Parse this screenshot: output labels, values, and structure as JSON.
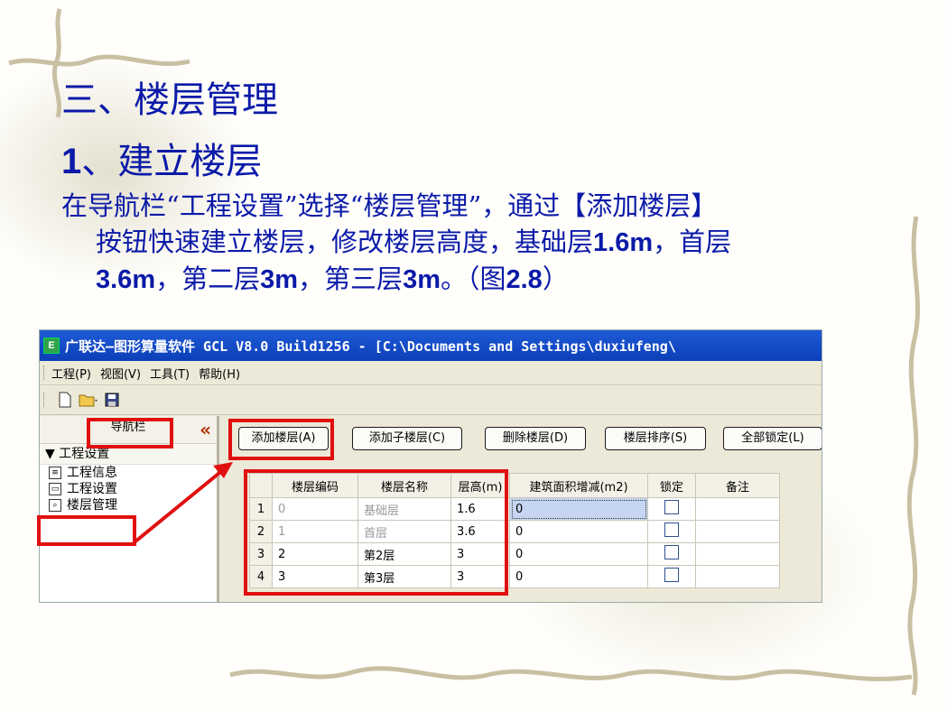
{
  "slide": {
    "title": "三、楼层管理",
    "subtitle_num": "1",
    "subtitle_text": "、建立楼层",
    "body_line1": "在导航栏“工程设置”选择“楼层管理”，通过【添加楼层】",
    "body_line2_a": "按钮快速建立楼层，修改楼层高度，基础层",
    "body_line2_b": "1.6m",
    "body_line2_c": "，首层",
    "body_line3_a": "3.6m",
    "body_line3_b": "，第二层",
    "body_line3_c": "3m",
    "body_line3_d": "，第三层",
    "body_line3_e": "3m",
    "body_line3_f": "。（图",
    "body_line3_g": "2.8",
    "body_line3_h": "）"
  },
  "app": {
    "title": "广联达—图形算量软件 GCL V8.0 Build1256 - [C:\\Documents and Settings\\duxiufeng\\",
    "icon_letter": "E",
    "menu": [
      "工程(P)",
      "视图(V)",
      "工具(T)",
      "帮助(H)"
    ],
    "toolbar_icons": [
      "new-file-icon",
      "open-folder-icon",
      "save-icon"
    ],
    "nav": {
      "header": "导航栏",
      "collapse_glyph": "«",
      "section": "▼ 工程设置",
      "items": [
        "工程信息",
        "工程设置",
        "楼层管理"
      ]
    },
    "buttons": [
      "添加楼层(A)",
      "添加子楼层(C)",
      "删除楼层(D)",
      "楼层排序(S)",
      "全部锁定(L)"
    ],
    "table": {
      "columns": [
        "楼层编码",
        "楼层名称",
        "层高(m)",
        "建筑面积增减(m2)",
        "锁定",
        "备注"
      ],
      "rows": [
        {
          "no": "1",
          "code": "0",
          "name": "基础层",
          "height": "1.6",
          "area": "0",
          "locked": false,
          "note": "",
          "muted": true
        },
        {
          "no": "2",
          "code": "1",
          "name": "首层",
          "height": "3.6",
          "area": "0",
          "locked": false,
          "note": "",
          "muted": true
        },
        {
          "no": "3",
          "code": "2",
          "name": "第2层",
          "height": "3",
          "area": "0",
          "locked": false,
          "note": "",
          "muted": false
        },
        {
          "no": "4",
          "code": "3",
          "name": "第3层",
          "height": "3",
          "area": "0",
          "locked": false,
          "note": "",
          "muted": false
        }
      ]
    }
  },
  "colors": {
    "title": "#0b1aa8",
    "highlight": "#e01010",
    "titlebar": "#0b3fb8"
  }
}
